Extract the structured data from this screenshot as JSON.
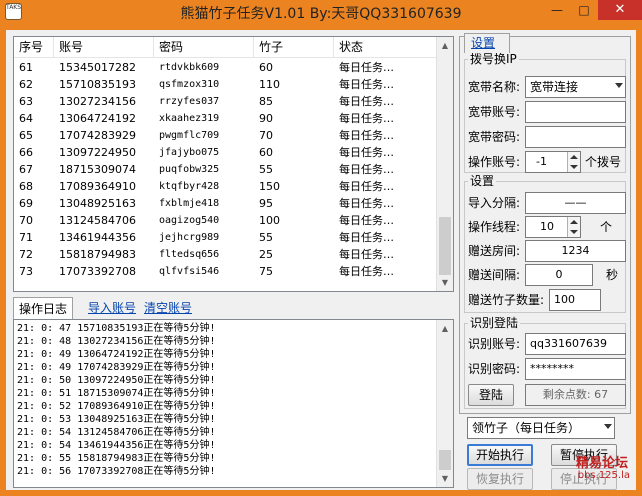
{
  "window": {
    "title": "熊猫竹子任务V1.01 By:天哥QQ331607639",
    "icon_text": "TAKS",
    "minimize": "—",
    "maximize": "□",
    "close": "✕"
  },
  "table": {
    "columns": [
      "序号",
      "账号",
      "密码",
      "竹子",
      "状态"
    ],
    "rows": [
      [
        "61",
        "15345017282",
        "rtdvkbk609",
        "60",
        "每日任务…"
      ],
      [
        "62",
        "15710835193",
        "qsfmzox310",
        "110",
        "每日任务…"
      ],
      [
        "63",
        "13027234156",
        "rrzyfes037",
        "85",
        "每日任务…"
      ],
      [
        "64",
        "13064724192",
        "xkaahez319",
        "90",
        "每日任务…"
      ],
      [
        "65",
        "17074283929",
        "pwgmflc709",
        "70",
        "每日任务…"
      ],
      [
        "66",
        "13097224950",
        "jfajybo075",
        "60",
        "每日任务…"
      ],
      [
        "67",
        "18715309074",
        "puqfobw325",
        "55",
        "每日任务…"
      ],
      [
        "68",
        "17089364910",
        "ktqfbyr428",
        "150",
        "每日任务…"
      ],
      [
        "69",
        "13048925163",
        "fxblmje418",
        "95",
        "每日任务…"
      ],
      [
        "70",
        "13124584706",
        "oagizog540",
        "100",
        "每日任务…"
      ],
      [
        "71",
        "13461944356",
        "jejhcrg989",
        "55",
        "每日任务…"
      ],
      [
        "72",
        "15818794983",
        "fltedsq656",
        "25",
        "每日任务…"
      ],
      [
        "73",
        "17073392708",
        "qlfvfsi546",
        "75",
        "每日任务…"
      ]
    ]
  },
  "log_tabs": {
    "log": "操作日志",
    "import": "导入账号",
    "clear": "清空账号"
  },
  "log_lines": [
    "21: 0: 47   15710835193正在等待5分钟!",
    "21: 0: 48   13027234156正在等待5分钟!",
    "21: 0: 49   13064724192正在等待5分钟!",
    "21: 0: 49   17074283929正在等待5分钟!",
    "21: 0: 50   13097224950正在等待5分钟!",
    "21: 0: 51   18715309074正在等待5分钟!",
    "21: 0: 52   17089364910正在等待5分钟!",
    "21: 0: 53   13048925163正在等待5分钟!",
    "21: 0: 54   13124584706正在等待5分钟!",
    "21: 0: 54   13461944356正在等待5分钟!",
    "21: 0: 55   15818794983正在等待5分钟!",
    "21: 0: 56   17073392708正在等待5分钟!"
  ],
  "settings": {
    "tab_label": "设置",
    "dial_group": "拨号换IP",
    "broadband_name_label": "宽带名称:",
    "broadband_name_value": "宽带连接",
    "broadband_account_label": "宽带账号:",
    "broadband_account_value": "",
    "broadband_password_label": "宽带密码:",
    "broadband_password_value": "",
    "op_account_label": "操作账号:",
    "op_account_value": "-1",
    "op_account_suffix": "个拨号",
    "settings_group": "设置",
    "import_sep_label": "导入分隔:",
    "import_sep_value": "——",
    "threads_label": "操作线程:",
    "threads_value": "10",
    "threads_suffix": "个",
    "gift_room_label": "赠送房间:",
    "gift_room_value": "1234",
    "gift_interval_label": "赠送间隔:",
    "gift_interval_value": "0",
    "gift_interval_unit": "秒",
    "gift_count_label": "赠送竹子数量:",
    "gift_count_value": "100",
    "captcha_group": "识别登陆",
    "captcha_account_label": "识别账号:",
    "captcha_account_value": "qq331607639",
    "captcha_password_label": "识别密码:",
    "captcha_password_value": "********",
    "login_button": "登陆",
    "remaining_points": "剩余点数: 67"
  },
  "controls": {
    "task_select": "领竹子（每日任务）",
    "start": "开始执行",
    "pause": "暂停执行",
    "resume": "恢复执行",
    "stop": "停止执行"
  },
  "watermark": {
    "line1": "精易论坛",
    "line2": "bbs.125.la"
  }
}
